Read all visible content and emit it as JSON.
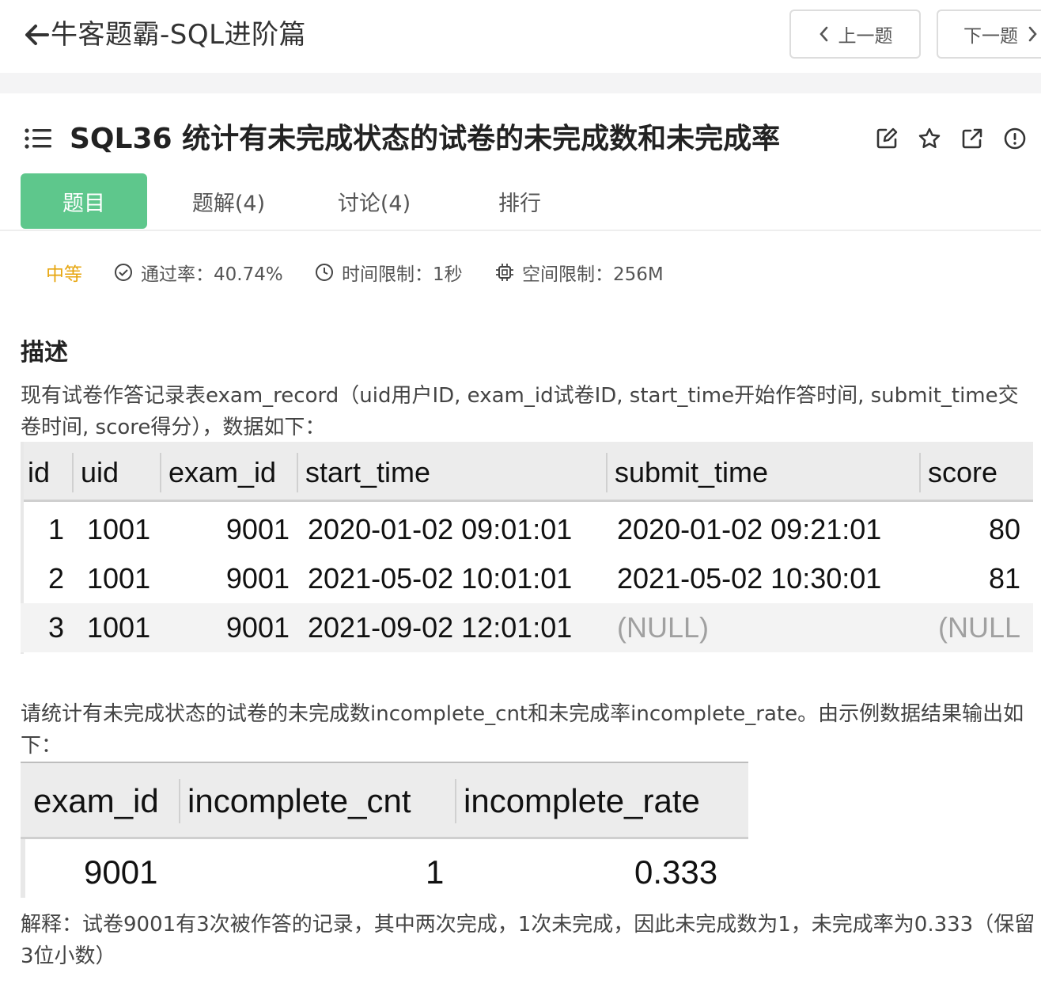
{
  "header": {
    "back_title": "牛客题霸-SQL进阶篇",
    "prev_label": "上一题",
    "next_label": "下一题"
  },
  "problem": {
    "title": "SQL36  统计有未完成状态的试卷的未完成数和未完成率"
  },
  "tabs": [
    {
      "label": "题目",
      "active": true
    },
    {
      "label": "题解(4)",
      "active": false
    },
    {
      "label": "讨论(4)",
      "active": false
    },
    {
      "label": "排行",
      "active": false
    }
  ],
  "meta": {
    "difficulty": "中等",
    "pass_rate": "通过率：40.74%",
    "time_limit": "时间限制：1秒",
    "space_limit": "空间限制：256M"
  },
  "description": {
    "heading": "描述",
    "intro": "现有试卷作答记录表exam_record（uid用户ID, exam_id试卷ID, start_time开始作答时间, submit_time交卷时间, score得分），数据如下：",
    "task": "请统计有未完成状态的试卷的未完成数incomplete_cnt和未完成率incomplete_rate。由示例数据结果输出如下：",
    "explain": "解释：试卷9001有3次被作答的记录，其中两次完成，1次未完成，因此未完成数为1，未完成率为0.333（保留3位小数）"
  },
  "exam_record_table": {
    "columns": [
      "id",
      "uid",
      "exam_id",
      "start_time",
      "submit_time",
      "score"
    ],
    "rows": [
      [
        "1",
        "1001",
        "9001",
        "2020-01-02 09:01:01",
        "2020-01-02 09:21:01",
        "80"
      ],
      [
        "2",
        "1001",
        "9001",
        "2021-05-02 10:01:01",
        "2021-05-02 10:30:01",
        "81"
      ],
      [
        "3",
        "1001",
        "9001",
        "2021-09-02 12:01:01",
        "(NULL)",
        "(NULL"
      ]
    ]
  },
  "result_table": {
    "columns": [
      "exam_id",
      "incomplete_cnt",
      "incomplete_rate"
    ],
    "rows": [
      [
        "9001",
        "1",
        "0.333"
      ]
    ]
  },
  "colors": {
    "accent": "#5ec78c",
    "difficulty": "#e7a60f"
  }
}
